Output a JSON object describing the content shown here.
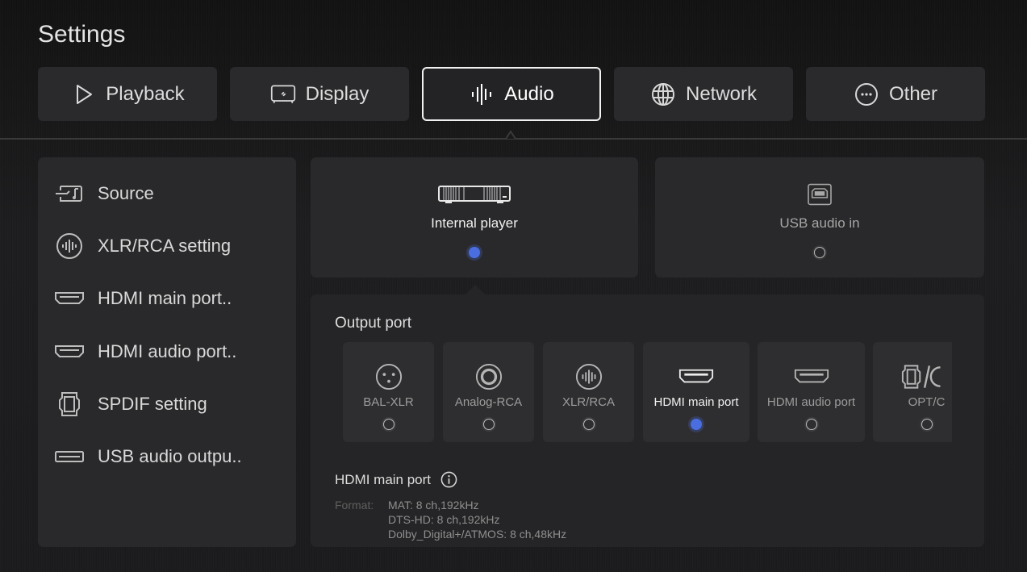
{
  "header": {
    "title": "Settings"
  },
  "tabs": [
    {
      "label": "Playback",
      "icon": "play-icon",
      "active": false
    },
    {
      "label": "Display",
      "icon": "tv-icon",
      "active": false
    },
    {
      "label": "Audio",
      "icon": "sound-wave-icon",
      "active": true
    },
    {
      "label": "Network",
      "icon": "globe-icon",
      "active": false
    },
    {
      "label": "Other",
      "icon": "more-icon",
      "active": false
    }
  ],
  "sidebar": {
    "items": [
      {
        "label": "Source",
        "icon": "source-icon"
      },
      {
        "label": "XLR/RCA setting",
        "icon": "sound-wave-circle-icon"
      },
      {
        "label": "HDMI main port..",
        "icon": "hdmi-icon"
      },
      {
        "label": "HDMI audio port..",
        "icon": "hdmi-icon"
      },
      {
        "label": "SPDIF setting",
        "icon": "spdif-icon"
      },
      {
        "label": "USB audio outpu..",
        "icon": "usb-icon"
      }
    ]
  },
  "sources": [
    {
      "label": "Internal player",
      "icon": "player-device-icon",
      "selected": true
    },
    {
      "label": "USB audio in",
      "icon": "usb-b-icon",
      "selected": false
    }
  ],
  "output": {
    "title": "Output port",
    "ports": [
      {
        "label": "BAL-XLR",
        "icon": "xlr-icon",
        "selected": false
      },
      {
        "label": "Analog-RCA",
        "icon": "rca-icon",
        "selected": false
      },
      {
        "label": "XLR/RCA",
        "icon": "sound-wave-circle-icon",
        "selected": false
      },
      {
        "label": "HDMI main port",
        "icon": "hdmi-icon",
        "selected": true
      },
      {
        "label": "HDMI audio port",
        "icon": "hdmi-icon",
        "selected": false
      },
      {
        "label": "OPT/C",
        "icon": "optical-coax-icon",
        "selected": false
      }
    ],
    "info": {
      "title": "HDMI main port",
      "format_label": "Format:",
      "formats": [
        "MAT: 8 ch,192kHz",
        "DTS-HD: 8 ch,192kHz",
        "Dolby_Digital+/ATMOS: 8 ch,48kHz"
      ]
    }
  },
  "colors": {
    "accent": "#4a6ee0",
    "active_border": "#f1f1f1"
  }
}
